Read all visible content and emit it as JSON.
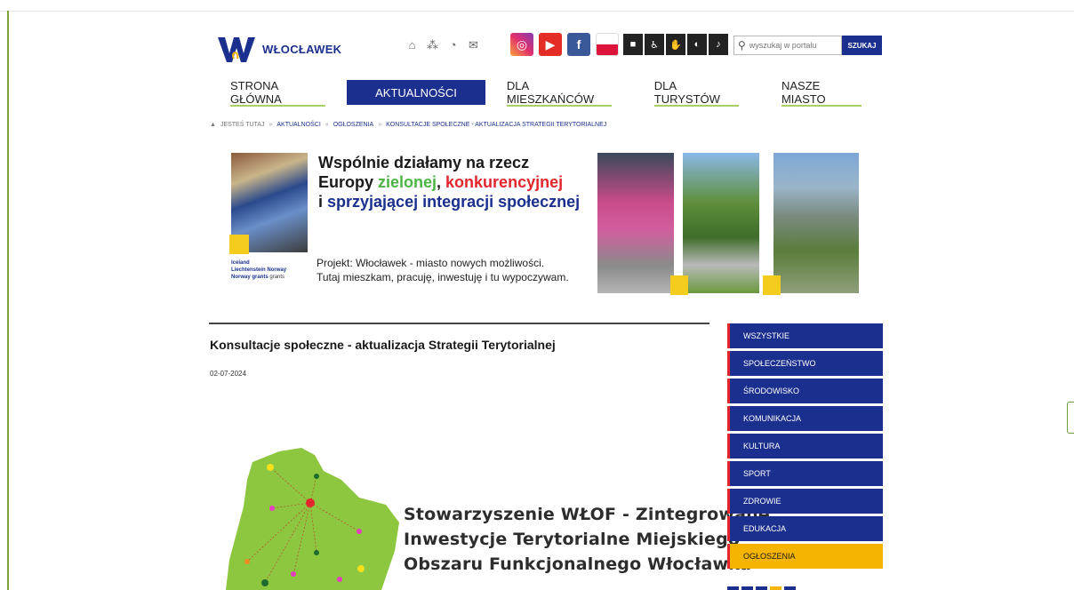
{
  "header": {
    "logo_text": "WŁOCŁAWEK",
    "util_icons": [
      "home-icon",
      "sitemap-icon",
      "rss-icon",
      "mail-icon"
    ],
    "social": [
      "instagram-icon",
      "youtube-icon",
      "facebook-icon",
      "polish-flag-icon"
    ],
    "accessibility": [
      "contrast-icon",
      "wheelchair-icon",
      "sign-language-icon",
      "deaf-icon",
      "guide-icon"
    ],
    "search": {
      "placeholder": "wyszukaj w portalu",
      "button": "SZUKAJ"
    }
  },
  "nav": {
    "items": [
      {
        "label": "STRONA GŁÓWNA"
      },
      {
        "label": "AKTUALNOŚCI"
      },
      {
        "label": "DLA MIESZKAŃCÓW"
      },
      {
        "label": "DLA TURYSTÓW"
      },
      {
        "label": "NASZE MIASTO"
      }
    ],
    "active_index": 1
  },
  "breadcrumb": {
    "prefix": "JESTEŚ TUTAJ",
    "items": [
      "AKTUALNOŚCI",
      "OGŁOSZENIA",
      "KONSULTACJE SPOŁECZNE - AKTUALIZACJA STRATEGII TERYTORIALNEJ"
    ],
    "separator": "»"
  },
  "banner": {
    "line1": "Wspólnie działamy na rzecz",
    "line2_a": "Europy ",
    "line2_green": "zielonej",
    "line2_b": ", ",
    "line2_red": "konkurencyjnej",
    "line3_a": "i ",
    "line3_blue": "sprzyjającej integracji społecznej",
    "sub1": "Projekt: Włocławek - miasto nowych możliwości.",
    "sub2": "Tutaj mieszkam, pracuję, inwestuję i tu wypoczywam.",
    "eea_1": "Iceland",
    "eea_2": "Liechtenstein",
    "eea_3": "Norway",
    "eea_4": "Norway grants",
    "eea_5": "grants"
  },
  "article": {
    "title": "Konsultacje społeczne - aktualizacja Strategii Terytorialnej",
    "date": "02-07-2024",
    "caption": [
      "Stowarzyszenie WŁOF - Zintegrowane",
      "Inwestycje Terytorialne Miejskiego",
      "Obszaru Funkcjonalnego Włocławka"
    ]
  },
  "categories": {
    "items": [
      "WSZYSTKIE",
      "SPOŁECZEŃSTWO",
      "ŚRODOWISKO",
      "KOMUNIKACJA",
      "KULTURA",
      "SPORT",
      "ZDROWIE",
      "EDUKACJA",
      "OGŁOSZENIA"
    ],
    "active_index": 8
  },
  "colors": {
    "primary": "#1b2f8e",
    "accent_yellow": "#f4b400",
    "accent_red": "#e3262d",
    "accent_green": "#a8cf63"
  }
}
